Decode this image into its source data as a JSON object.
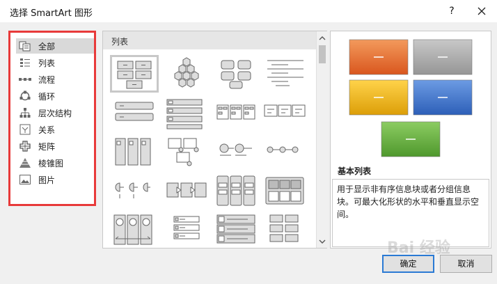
{
  "dialog": {
    "title": "选择 SmartArt 图形",
    "help": "?"
  },
  "categories": {
    "items": [
      {
        "label": "全部",
        "icon": "all-icon",
        "selected": true
      },
      {
        "label": "列表",
        "icon": "list-icon"
      },
      {
        "label": "流程",
        "icon": "process-icon"
      },
      {
        "label": "循环",
        "icon": "cycle-icon"
      },
      {
        "label": "层次结构",
        "icon": "hierarchy-icon"
      },
      {
        "label": "关系",
        "icon": "relationship-icon"
      },
      {
        "label": "矩阵",
        "icon": "matrix-icon"
      },
      {
        "label": "棱锥图",
        "icon": "pyramid-icon"
      },
      {
        "label": "图片",
        "icon": "picture-icon"
      }
    ]
  },
  "gallery": {
    "title": "列表"
  },
  "preview": {
    "name": "基本列表",
    "description": "用于显示非有序信息块或者分组信息块。可最大化形状的水平和垂直显示空间。",
    "colors": [
      "#e0642a",
      "#a8a8a8",
      "#e4a910",
      "#3a6fc7",
      "#5fa83a"
    ]
  },
  "buttons": {
    "ok": "确定",
    "cancel": "取消"
  },
  "watermark": "Bai 经验"
}
